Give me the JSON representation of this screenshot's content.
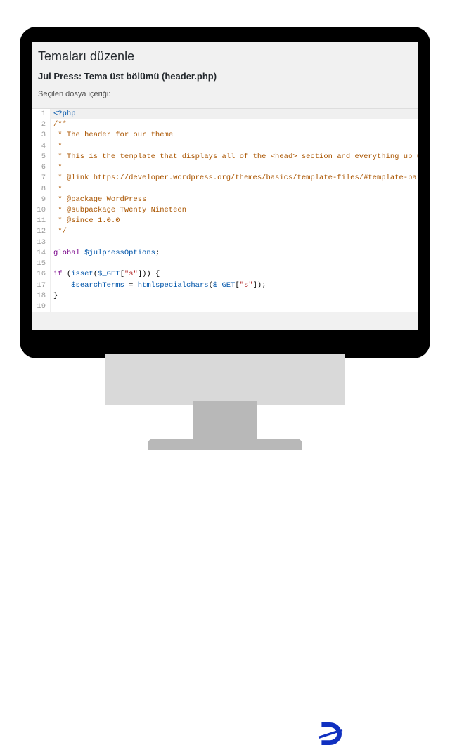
{
  "header": {
    "page_title": "Temaları düzenle",
    "subtitle": "Jul Press: Tema üst bölümü (header.php)",
    "content_label": "Seçilen dosya içeriği:"
  },
  "editor": {
    "lines": [
      {
        "n": 1,
        "spans": [
          {
            "c": "c-php",
            "t": "<?php"
          }
        ],
        "active": true
      },
      {
        "n": 2,
        "spans": [
          {
            "c": "c-cmt",
            "t": "/**"
          }
        ]
      },
      {
        "n": 3,
        "spans": [
          {
            "c": "c-cmt",
            "t": " * The header for our theme"
          }
        ]
      },
      {
        "n": 4,
        "spans": [
          {
            "c": "c-cmt",
            "t": " *"
          }
        ]
      },
      {
        "n": 5,
        "spans": [
          {
            "c": "c-cmt",
            "t": " * This is the template that displays all of the <head> section and everything up until <div id=\"conte"
          }
        ]
      },
      {
        "n": 6,
        "spans": [
          {
            "c": "c-cmt",
            "t": " *"
          }
        ]
      },
      {
        "n": 7,
        "spans": [
          {
            "c": "c-cmt",
            "t": " * @link https://developer.wordpress.org/themes/basics/template-files/#template-partials"
          }
        ]
      },
      {
        "n": 8,
        "spans": [
          {
            "c": "c-cmt",
            "t": " *"
          }
        ]
      },
      {
        "n": 9,
        "spans": [
          {
            "c": "c-cmt",
            "t": " * @package WordPress"
          }
        ]
      },
      {
        "n": 10,
        "spans": [
          {
            "c": "c-cmt",
            "t": " * @subpackage Twenty_Nineteen"
          }
        ]
      },
      {
        "n": 11,
        "spans": [
          {
            "c": "c-cmt",
            "t": " * @since 1.0.0"
          }
        ]
      },
      {
        "n": 12,
        "spans": [
          {
            "c": "c-cmt",
            "t": " */"
          }
        ]
      },
      {
        "n": 13,
        "spans": [
          {
            "c": "",
            "t": ""
          }
        ]
      },
      {
        "n": 14,
        "spans": [
          {
            "c": "c-kw",
            "t": "global"
          },
          {
            "c": "",
            "t": " "
          },
          {
            "c": "c-var",
            "t": "$julpressOptions"
          },
          {
            "c": "",
            "t": ";"
          }
        ]
      },
      {
        "n": 15,
        "spans": [
          {
            "c": "",
            "t": ""
          }
        ]
      },
      {
        "n": 16,
        "spans": [
          {
            "c": "c-kw",
            "t": "if"
          },
          {
            "c": "",
            "t": " ("
          },
          {
            "c": "c-fn",
            "t": "isset"
          },
          {
            "c": "",
            "t": "("
          },
          {
            "c": "c-var",
            "t": "$_GET"
          },
          {
            "c": "",
            "t": "["
          },
          {
            "c": "c-str",
            "t": "\"s\""
          },
          {
            "c": "",
            "t": "])) {"
          }
        ]
      },
      {
        "n": 17,
        "spans": [
          {
            "c": "",
            "t": "    "
          },
          {
            "c": "c-var",
            "t": "$searchTerms"
          },
          {
            "c": "",
            "t": " = "
          },
          {
            "c": "c-fn",
            "t": "htmlspecialchars"
          },
          {
            "c": "",
            "t": "("
          },
          {
            "c": "c-var",
            "t": "$_GET"
          },
          {
            "c": "",
            "t": "["
          },
          {
            "c": "c-str",
            "t": "\"s\""
          },
          {
            "c": "",
            "t": "]);"
          }
        ]
      },
      {
        "n": 18,
        "spans": [
          {
            "c": "",
            "t": "}"
          }
        ]
      },
      {
        "n": 19,
        "spans": [
          {
            "c": "",
            "t": ""
          }
        ]
      }
    ]
  },
  "logo_letter": "D"
}
